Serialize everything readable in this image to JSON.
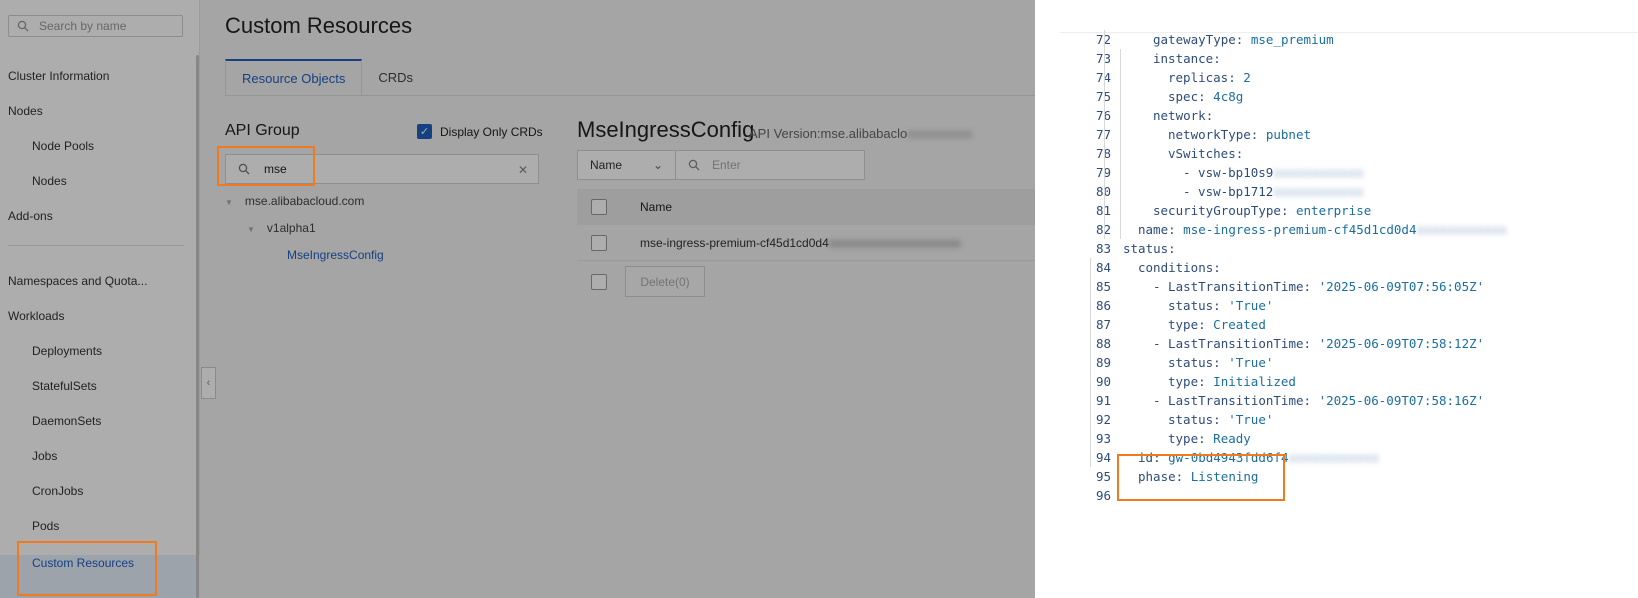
{
  "sidebar": {
    "search_placeholder": "Search by name",
    "items": [
      {
        "label": "Cluster Information"
      },
      {
        "label": "Nodes"
      },
      {
        "label": "Node Pools"
      },
      {
        "label": "Nodes"
      },
      {
        "label": "Add-ons"
      },
      {
        "label": "Namespaces and Quota..."
      },
      {
        "label": "Workloads"
      },
      {
        "label": "Deployments"
      },
      {
        "label": "StatefulSets"
      },
      {
        "label": "DaemonSets"
      },
      {
        "label": "Jobs"
      },
      {
        "label": "CronJobs"
      },
      {
        "label": "Pods"
      },
      {
        "label": "Custom Resources"
      }
    ]
  },
  "main": {
    "title": "Custom Resources",
    "tabs": [
      {
        "label": "Resource Objects"
      },
      {
        "label": "CRDs"
      }
    ],
    "api_group_title": "API Group",
    "display_only_crds": "Display Only CRDs",
    "group_search_value": "mse",
    "tree": {
      "group": "mse.alibabacloud.com",
      "version": "v1alpha1",
      "kind": "MseIngressConfig"
    },
    "resource_title": "MseIngressConfig",
    "api_version_label": "API Version:mse.alibabaclo",
    "filter_select": "Name",
    "filter_placeholder": "Enter",
    "table_header_name": "Name",
    "row_name": "mse-ingress-premium-cf45d1cd0d4",
    "delete_button": "Delete(0)"
  },
  "code": {
    "lines": [
      {
        "n": "72",
        "key": "gatewayType",
        "val": "mse_premium"
      },
      {
        "n": "73",
        "key": "instance",
        "val": ""
      },
      {
        "n": "74",
        "key": "replicas",
        "val": "2"
      },
      {
        "n": "75",
        "key": "spec",
        "val": "4c8g"
      },
      {
        "n": "76",
        "key": "network",
        "val": ""
      },
      {
        "n": "77",
        "key": "networkType",
        "val": "pubnet"
      },
      {
        "n": "78",
        "key": "vSwitches",
        "val": ""
      },
      {
        "n": "79",
        "key": "- vsw-bp10s9",
        "val": ""
      },
      {
        "n": "80",
        "key": "- vsw-bp1712",
        "val": ""
      },
      {
        "n": "81",
        "key": "securityGroupType",
        "val": "enterprise"
      },
      {
        "n": "82",
        "key": "name",
        "val": "mse-ingress-premium-cf45d1cd0d4"
      },
      {
        "n": "83",
        "key": "status",
        "val": ""
      },
      {
        "n": "84",
        "key": "conditions",
        "val": ""
      },
      {
        "n": "85",
        "key": "- LastTransitionTime",
        "val": "'2025-06-09T07:56:05Z'"
      },
      {
        "n": "86",
        "key": "status",
        "val": "'True'"
      },
      {
        "n": "87",
        "key": "type",
        "val": "Created"
      },
      {
        "n": "88",
        "key": "- LastTransitionTime",
        "val": "'2025-06-09T07:58:12Z'"
      },
      {
        "n": "89",
        "key": "status",
        "val": "'True'"
      },
      {
        "n": "90",
        "key": "type",
        "val": "Initialized"
      },
      {
        "n": "91",
        "key": "- LastTransitionTime",
        "val": "'2025-06-09T07:58:16Z'"
      },
      {
        "n": "92",
        "key": "status",
        "val": "'True'"
      },
      {
        "n": "93",
        "key": "type",
        "val": "Ready"
      },
      {
        "n": "94",
        "key": "id",
        "val": "gw-0bd4943fdd6f4"
      },
      {
        "n": "95",
        "key": "phase",
        "val": "Listening"
      },
      {
        "n": "96",
        "key": "",
        "val": ""
      }
    ]
  },
  "colors": {
    "highlight": "#f07a1f",
    "accent": "#1f5fbf"
  }
}
